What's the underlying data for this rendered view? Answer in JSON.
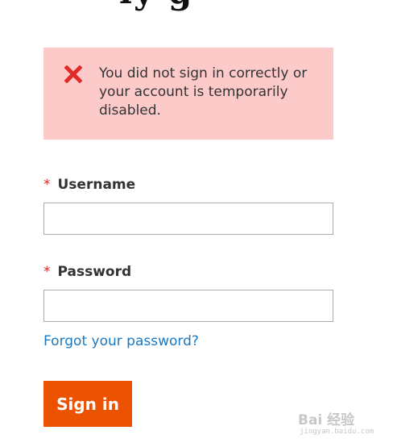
{
  "page": {
    "heading_fragment": "ly g"
  },
  "error": {
    "message": "You did not sign in correctly or your account is temporarily disabled.",
    "icon": "error-x-icon",
    "background_color": "#fdcaca",
    "icon_color": "#e02b27"
  },
  "form": {
    "username": {
      "required_mark": "*",
      "label": "Username",
      "value": "",
      "placeholder": ""
    },
    "password": {
      "required_mark": "*",
      "label": "Password",
      "value": "",
      "placeholder": ""
    },
    "forgot_label": "Forgot your password?",
    "submit_label": "Sign in"
  },
  "colors": {
    "accent": "#eb5202",
    "link": "#1979c3",
    "required": "#e02b27"
  },
  "watermark": {
    "text": "Bai 经验",
    "sub": "jingyan.baidu.com"
  }
}
